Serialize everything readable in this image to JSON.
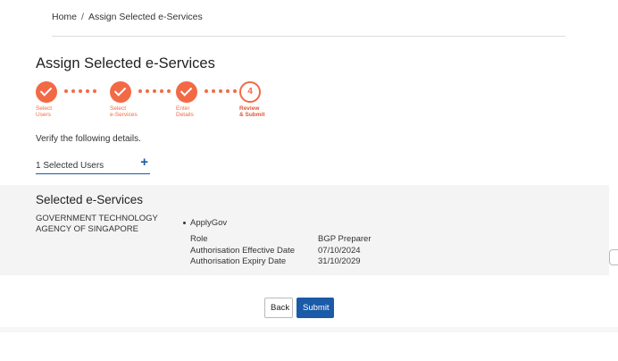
{
  "breadcrumb": {
    "home": "Home",
    "separator": "/",
    "current": "Assign Selected e-Services"
  },
  "page": {
    "title": "Assign Selected e-Services",
    "verify_text": "Verify the following details."
  },
  "colors": {
    "accent": "#f26a45",
    "primary": "#1a5aa8",
    "panel_bg": "#f4f4f4"
  },
  "stepper": {
    "steps": [
      {
        "label": "Select\nUsers",
        "state": "done",
        "icon": "check-icon"
      },
      {
        "label": "Select\ne-Services",
        "state": "done",
        "icon": "check-icon"
      },
      {
        "label": "Enter\nDetails",
        "state": "done",
        "icon": "check-icon"
      },
      {
        "label": "Review\n& Submit",
        "state": "current",
        "number": "4"
      }
    ]
  },
  "selected_users": {
    "label": "1 Selected Users",
    "add_icon": "plus-icon"
  },
  "eservices": {
    "title": "Selected e-Services",
    "agency": "GOVERNMENT TECHNOLOGY AGENCY OF SINGAPORE",
    "service_name": "ApplyGov",
    "details": [
      {
        "key": "Role",
        "value": "BGP Preparer"
      },
      {
        "key": "Authorisation Effective Date",
        "value": "07/10/2024"
      },
      {
        "key": "Authorisation Expiry Date",
        "value": "31/10/2029"
      }
    ]
  },
  "actions": {
    "back": "Back",
    "submit": "Submit"
  }
}
